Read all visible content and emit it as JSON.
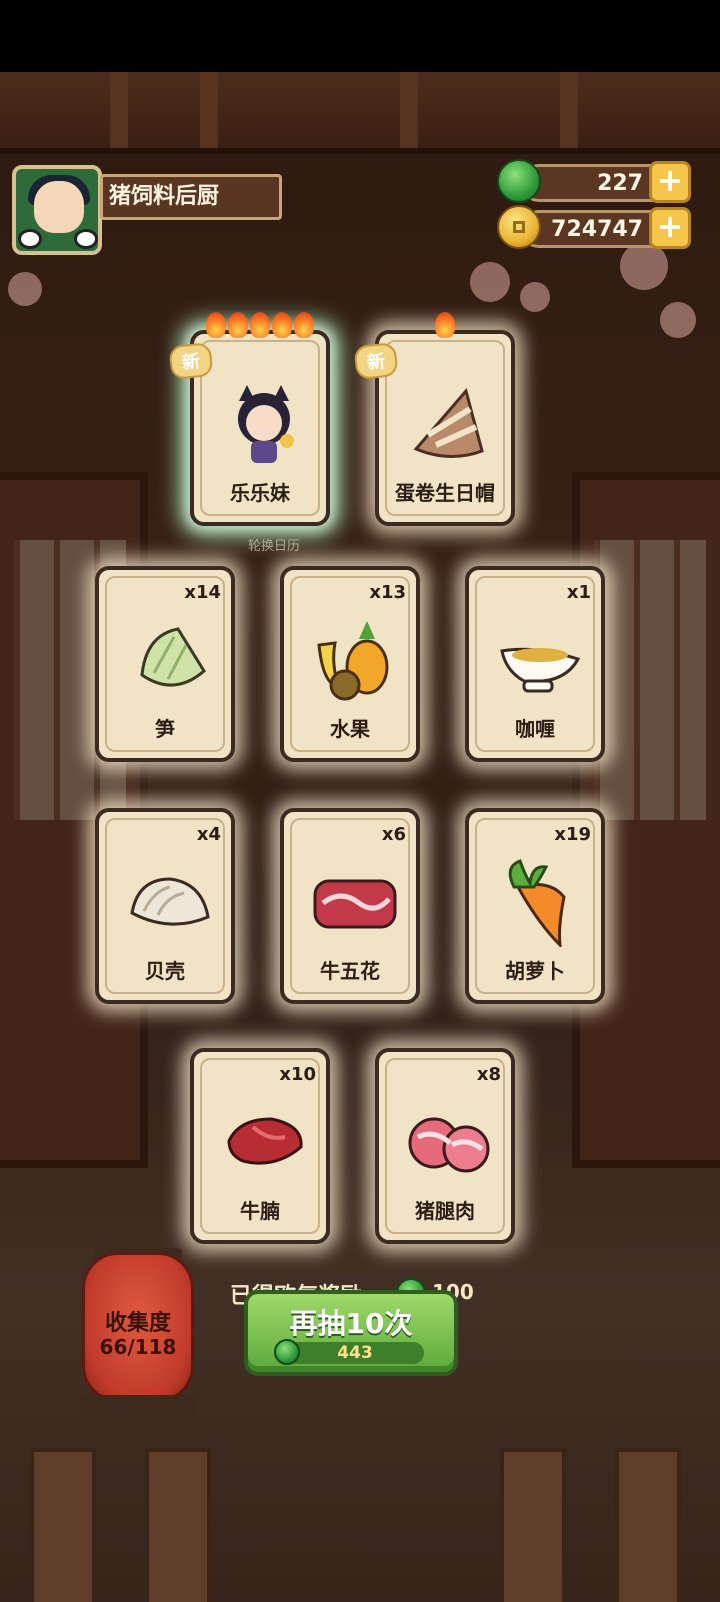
{
  "player": {
    "name": "猪饲料后厨"
  },
  "currencies": [
    {
      "icon": "jade-icon",
      "value": "227"
    },
    {
      "icon": "coin-icon",
      "value": "724747"
    }
  ],
  "faint_label": "轮换日历",
  "cards": [
    {
      "name": "乐乐妹",
      "qty": "",
      "badge": "新",
      "flames": 5,
      "rarity_glow": "rainbow",
      "icon": "character-girl-icon"
    },
    {
      "name": "蛋卷生日帽",
      "qty": "",
      "badge": "新",
      "flames": 1,
      "rarity_glow": "white",
      "icon": "party-hat-icon"
    },
    {
      "name": "笋",
      "qty": "x14",
      "icon": "bamboo-shoot-icon"
    },
    {
      "name": "水果",
      "qty": "x13",
      "icon": "fruit-basket-icon"
    },
    {
      "name": "咖喱",
      "qty": "x1",
      "icon": "curry-gravy-boat-icon"
    },
    {
      "name": "贝壳",
      "qty": "x4",
      "icon": "clam-shell-icon"
    },
    {
      "name": "牛五花",
      "qty": "x6",
      "icon": "beef-belly-icon"
    },
    {
      "name": "胡萝卜",
      "qty": "x19",
      "icon": "carrot-icon"
    },
    {
      "name": "牛腩",
      "qty": "x10",
      "icon": "beef-brisket-icon"
    },
    {
      "name": "猪腿肉",
      "qty": "x8",
      "icon": "pork-leg-icon"
    }
  ],
  "reward": {
    "label": "已得欧气奖励",
    "value": "100",
    "icon": "jade-icon"
  },
  "collection": {
    "label": "收集度",
    "progress": "66/118"
  },
  "draw_button": {
    "label": "再抽10次",
    "cost": "443",
    "cost_icon": "jade-icon"
  },
  "colors": {
    "button_green": "#5aa83a",
    "lantern_red": "#c23b2b",
    "card_bg": "#f1e4c6",
    "plus_gold": "#f5c64a"
  }
}
